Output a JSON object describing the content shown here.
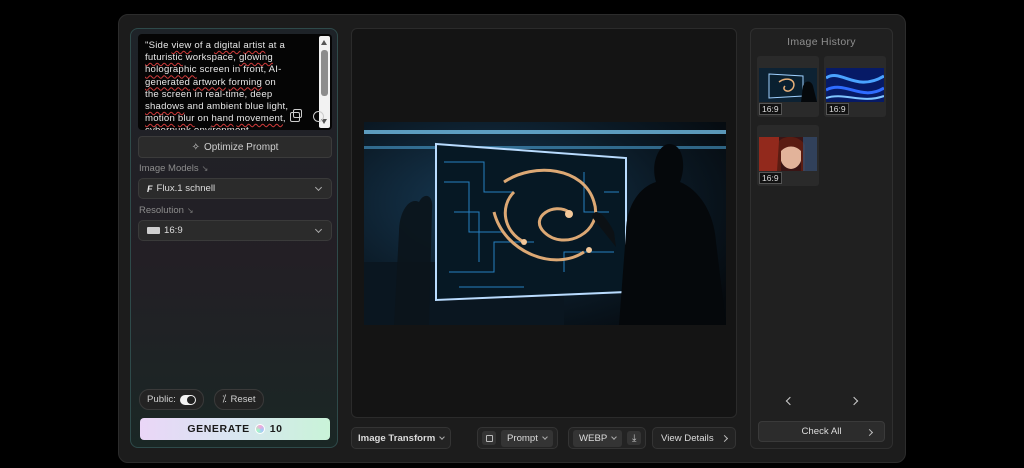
{
  "prompt": {
    "lines": [
      [
        {
          "t": "\"Side "
        },
        {
          "t": "view",
          "sp": true
        },
        {
          "t": " of a "
        },
        {
          "t": "digital",
          "sp": true
        },
        {
          "t": " "
        },
        {
          "t": "artist",
          "sp": true
        },
        {
          "t": " at a"
        }
      ],
      [
        {
          "t": "futuristic",
          "sp": true
        },
        {
          "t": " workspace, "
        },
        {
          "t": "glowing",
          "sp": true
        }
      ],
      [
        {
          "t": "holographic",
          "sp": true
        },
        {
          "t": " screen in front, AI-"
        }
      ],
      [
        {
          "t": "generated",
          "sp": true
        },
        {
          "t": " "
        },
        {
          "t": "artwork",
          "sp": true
        },
        {
          "t": " "
        },
        {
          "t": "forming",
          "sp": true
        },
        {
          "t": " on"
        }
      ],
      [
        {
          "t": "the screen in real-time, deep"
        }
      ],
      [
        {
          "t": "shadows",
          "sp": true
        },
        {
          "t": " and ambient blue light,"
        }
      ],
      [
        {
          "t": "motion",
          "sp": true
        },
        {
          "t": " "
        },
        {
          "t": "blur",
          "sp": true
        },
        {
          "t": " on "
        },
        {
          "t": "hand",
          "sp": true
        },
        {
          "t": " "
        },
        {
          "t": "movement",
          "sp": true
        },
        {
          "t": ","
        }
      ],
      [
        {
          "t": "cyberpunk environment"
        }
      ]
    ]
  },
  "optimize_label": "Optimize Prompt",
  "models": {
    "label": "Image Models",
    "value": "Flux.1 schnell"
  },
  "resolution": {
    "label": "Resolution",
    "value": "16:9"
  },
  "public_label": "Public:",
  "public_on": true,
  "reset_label": "Reset",
  "generate": {
    "label": "GENERATE",
    "credits": "10"
  },
  "toolbar": {
    "transform": "Image Transform",
    "prompt": "Prompt",
    "format": "WEBP",
    "details": "View Details"
  },
  "history": {
    "title": "Image History",
    "items": [
      {
        "ratio": "16:9",
        "kind": "workspace"
      },
      {
        "ratio": "16:9",
        "kind": "blue-waves"
      },
      {
        "ratio": "16:9",
        "kind": "portrait"
      }
    ],
    "check_all": "Check All"
  },
  "colors": {
    "accent_teal": "#2e4a4a",
    "generate_start": "#ead6f7",
    "generate_end": "#c9f3d8"
  }
}
